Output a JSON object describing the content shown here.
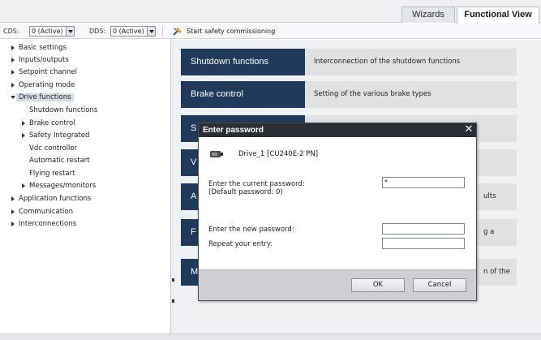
{
  "tabs": {
    "wizards": "Wizards",
    "functional_view": "Functional View"
  },
  "toolbar": {
    "cds_label": "CDS:",
    "cds_value": "0 (Active)",
    "dds_label": "DDS:",
    "dds_value": "0 (Active)",
    "commission_label": "Start safety commissioning"
  },
  "tree": {
    "basic_settings": "Basic settings",
    "inputs_outputs": "Inputs/outputs",
    "setpoint_channel": "Setpoint channel",
    "operating_mode": "Operating mode",
    "drive_functions": "Drive functions",
    "shutdown_functions": "Shutdown functions",
    "brake_control": "Brake control",
    "safety_integrated": "Safety Integrated",
    "vdc_controller": "Vdc controller",
    "automatic_restart": "Automatic restart",
    "flying_restart": "Flying restart",
    "messages_monitors": "Messages/monitors",
    "application_functions": "Application functions",
    "communication": "Communication",
    "interconnections": "Interconnections"
  },
  "functions": {
    "shutdown": {
      "button": "Shutdown functions",
      "description": "Interconnection of the shutdown functions"
    },
    "brake": {
      "button": "Brake control",
      "description": "Setting of the various brake types"
    },
    "row3": {
      "button": "S",
      "description": ""
    },
    "row4": {
      "button": "V",
      "description": ""
    },
    "row5": {
      "button": "A",
      "description": "ults"
    },
    "row6": {
      "button": "F",
      "description": "g a"
    },
    "row7": {
      "button": "M",
      "description": "n of the"
    }
  },
  "dialog": {
    "title": "Enter password",
    "close_glyph": "✕",
    "device_name": "Drive_1 [CU240E-2 PN]",
    "current_password_label": "Enter the current password:",
    "default_password_hint": "(Default password: 0)",
    "current_password_value": "*",
    "new_password_label": "Enter the new password:",
    "repeat_label": "Repeat your entry:",
    "ok_label": "OK",
    "cancel_label": "Cancel"
  },
  "colors": {
    "function_button": "#1f3a5a",
    "dialog_title_bar": "#2a2f35",
    "dialog_footer": "#cdcfd2"
  }
}
